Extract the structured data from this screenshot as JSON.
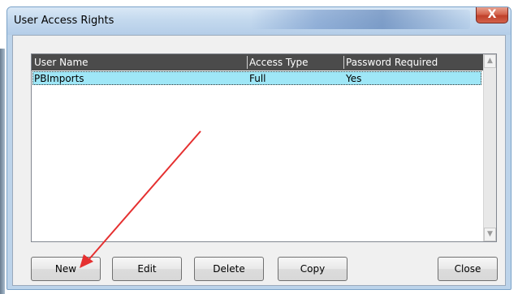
{
  "window": {
    "title": "User Access Rights",
    "close_glyph": "X"
  },
  "list": {
    "columns": [
      "User Name",
      "Access Type",
      "Password Required"
    ],
    "rows": [
      {
        "user_name": "PBImports",
        "access_type": "Full",
        "password_required": "Yes"
      }
    ]
  },
  "scrollbar": {
    "up_glyph": "▲",
    "down_glyph": "▼"
  },
  "buttons": {
    "new": "New",
    "edit": "Edit",
    "delete": "Delete",
    "copy": "Copy",
    "close": "Close"
  },
  "annotation": {
    "arrow_color": "#e53030"
  },
  "colors": {
    "selected_row": "#9fe7f7",
    "header_bg": "#4b4b4b"
  }
}
